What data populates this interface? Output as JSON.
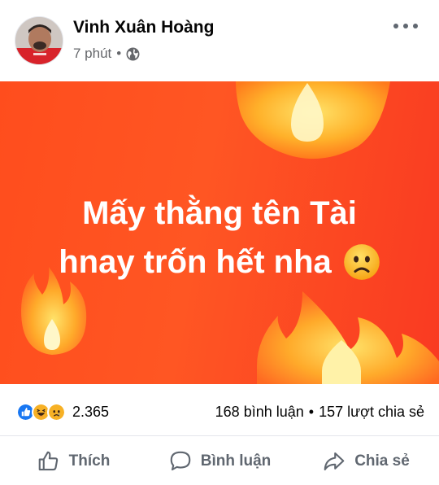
{
  "post": {
    "author": "Vinh Xuân Hoàng",
    "time": "7 phút",
    "separator": "•",
    "privacy_icon": "globe-icon",
    "card": {
      "line1": "Mấy thằng tên Tài",
      "line2": "hnay trốn hết nha",
      "emoji": "frowning-face",
      "background": "#ff4d1d"
    }
  },
  "stats": {
    "reactions": [
      "like-icon",
      "haha-icon",
      "sad-icon"
    ],
    "reaction_count": "2.365",
    "comments": "168 bình luận",
    "dot": "•",
    "shares": "157 lượt chia sẻ"
  },
  "actions": {
    "like": "Thích",
    "comment": "Bình luận",
    "share": "Chia sẻ"
  },
  "colors": {
    "secondary_text": "#65676b",
    "like_blue": "#1877f2",
    "reaction_yellow": "#f7b125"
  }
}
